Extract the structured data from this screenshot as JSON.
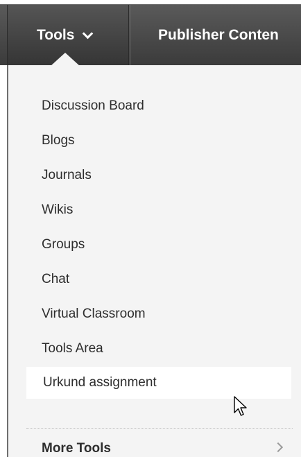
{
  "toolbar": {
    "tools_label": "Tools",
    "publisher_label": "Publisher Conten"
  },
  "menu": {
    "items": [
      {
        "label": "Discussion Board"
      },
      {
        "label": "Blogs"
      },
      {
        "label": "Journals"
      },
      {
        "label": "Wikis"
      },
      {
        "label": "Groups"
      },
      {
        "label": "Chat"
      },
      {
        "label": "Virtual Classroom"
      },
      {
        "label": "Tools Area"
      },
      {
        "label": "Urkund assignment"
      }
    ],
    "highlighted_index": 8,
    "more_tools_label": "More Tools"
  },
  "icons": {
    "tools_chevron": "chevron-down-icon",
    "more_chevron": "chevron-right-icon",
    "cursor": "mouse-pointer-icon"
  },
  "colors": {
    "toolbar_bg": "#4a4a4a",
    "panel_bg": "#f4f4f4",
    "highlight_bg": "#ffffff",
    "text": "#2d2d2d"
  }
}
